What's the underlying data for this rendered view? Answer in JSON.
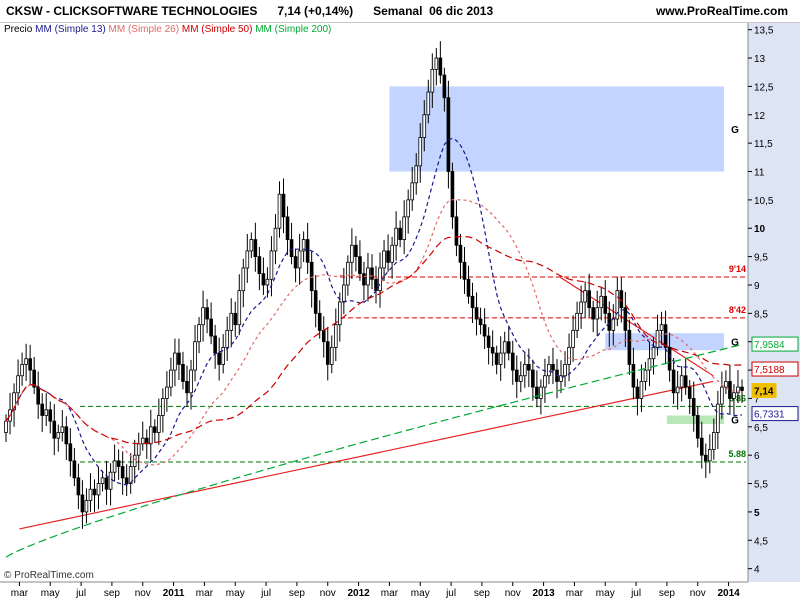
{
  "header": {
    "title": "CKSW - CLICKSOFTWARE TECHNOLOGIES",
    "price": "7,14 (+0,14%)",
    "period": "Semanal",
    "date": "06 dic 2013",
    "source": "www.ProRealTime.com"
  },
  "legend": {
    "price_label": "Precio",
    "ma13": "MM (Simple 13)",
    "ma26": "MM (Simple 26)",
    "ma50": "MM (Simple 50)",
    "ma200": "MM (Simple 200)"
  },
  "watermark": "© ProRealTime.com",
  "colors": {
    "ma13": "#1a1a8c",
    "ma26": "#e06a6a",
    "ma50": "#cc0000",
    "ma200": "#00aa33",
    "trend": "#e62020",
    "level_red": "#d80000",
    "level_green": "#007700",
    "zone_blue": "#c2d4ff",
    "zone_green": "#b8e8b8",
    "axis_bg": "#dde4f4"
  },
  "chart_data": {
    "type": "candlestick",
    "x_ticks": [
      "mar",
      "may",
      "jul",
      "sep",
      "nov",
      "2011",
      "mar",
      "may",
      "jul",
      "sep",
      "nov",
      "2012",
      "mar",
      "may",
      "jul",
      "sep",
      "nov",
      "2013",
      "mar",
      "may",
      "jul",
      "sep",
      "nov",
      "2014"
    ],
    "ylim": [
      3.8,
      13.6
    ],
    "y_ticks": [
      "4",
      "4,5",
      "5",
      "5,5",
      "6",
      "6,5",
      "7",
      "7,5",
      "8",
      "8,5",
      "9",
      "9,5",
      "10",
      "10,5",
      "11",
      "11,5",
      "12",
      "12,5",
      "13",
      "13,5"
    ],
    "price_tags": [
      {
        "label": "7,9584",
        "color": "#00aa33",
        "value": 7.9584
      },
      {
        "label": "7,5188",
        "color": "#cc0000",
        "value": 7.5188
      },
      {
        "label": "7,14",
        "color": "#f0c000",
        "value": 7.14
      },
      {
        "label": "6,7331",
        "color": "#1a1a8c",
        "value": 6.7331
      }
    ],
    "levels": [
      {
        "label": "9'14",
        "value": 9.14,
        "style": "red"
      },
      {
        "label": "8'42",
        "value": 8.42,
        "style": "red"
      },
      {
        "label": "6'86",
        "value": 6.86,
        "style": "green"
      },
      {
        "label": "5.88",
        "value": 5.88,
        "style": "green"
      }
    ],
    "zones": [
      {
        "label": "G",
        "from": 11.0,
        "to": 12.5,
        "start": "2012-04",
        "color": "blue"
      },
      {
        "label": "G",
        "from": 7.85,
        "to": 8.15,
        "start": "2013-06",
        "color": "blue"
      },
      {
        "label": "G",
        "from": 6.55,
        "to": 6.7,
        "start": "2013-10",
        "color": "green"
      }
    ],
    "trendlines": [
      {
        "from": [
          "2010-04",
          4.7
        ],
        "to": [
          "2014-01",
          7.3
        ]
      },
      {
        "from": [
          "2013-03",
          9.15
        ],
        "to": [
          "2014-01",
          7.4
        ]
      }
    ],
    "weekly_close": [
      6.6,
      6.8,
      7.1,
      7.4,
      7.6,
      7.7,
      7.5,
      7.2,
      6.9,
      6.7,
      6.8,
      6.6,
      6.3,
      6.4,
      6.5,
      6.2,
      5.9,
      5.6,
      5.3,
      5.0,
      5.2,
      5.4,
      5.3,
      5.5,
      5.6,
      5.4,
      5.7,
      5.9,
      5.8,
      5.6,
      5.5,
      5.8,
      6.0,
      6.2,
      6.3,
      6.2,
      6.5,
      6.4,
      6.7,
      7.0,
      7.2,
      7.5,
      7.8,
      7.6,
      7.3,
      7.1,
      7.5,
      8.0,
      8.3,
      8.6,
      8.4,
      8.1,
      7.8,
      7.6,
      7.9,
      8.2,
      8.5,
      8.3,
      8.9,
      9.3,
      9.6,
      9.8,
      9.5,
      9.2,
      9.0,
      9.1,
      9.6,
      10.0,
      10.6,
      10.2,
      9.8,
      9.5,
      9.3,
      9.6,
      9.8,
      9.4,
      8.9,
      8.5,
      8.2,
      8.0,
      7.6,
      7.9,
      8.3,
      8.7,
      9.0,
      9.4,
      9.7,
      9.5,
      9.2,
      9.0,
      9.3,
      9.1,
      8.9,
      9.3,
      9.6,
      9.4,
      9.7,
      10.0,
      9.8,
      10.2,
      10.5,
      10.8,
      11.1,
      11.6,
      12.0,
      12.4,
      12.8,
      13.0,
      12.7,
      12.3,
      11.0,
      10.2,
      9.7,
      9.4,
      9.1,
      8.8,
      8.6,
      8.4,
      8.3,
      8.1,
      7.9,
      7.8,
      7.6,
      7.8,
      8.0,
      7.8,
      7.5,
      7.3,
      7.4,
      7.6,
      7.5,
      7.2,
      7.0,
      7.2,
      7.4,
      7.6,
      7.5,
      7.3,
      7.4,
      7.6,
      7.9,
      8.2,
      8.5,
      8.7,
      8.9,
      8.6,
      8.4,
      8.6,
      8.8,
      8.5,
      8.2,
      8.4,
      8.9,
      8.6,
      8.2,
      7.6,
      7.2,
      7.0,
      7.3,
      7.5,
      7.7,
      7.9,
      8.2,
      8.3,
      7.9,
      7.5,
      7.1,
      7.2,
      7.4,
      7.2,
      7.0,
      6.7,
      6.3,
      6.0,
      5.9,
      6.1,
      6.4,
      6.9,
      7.2,
      7.3,
      7.0,
      7.1,
      7.2,
      7.14
    ]
  }
}
